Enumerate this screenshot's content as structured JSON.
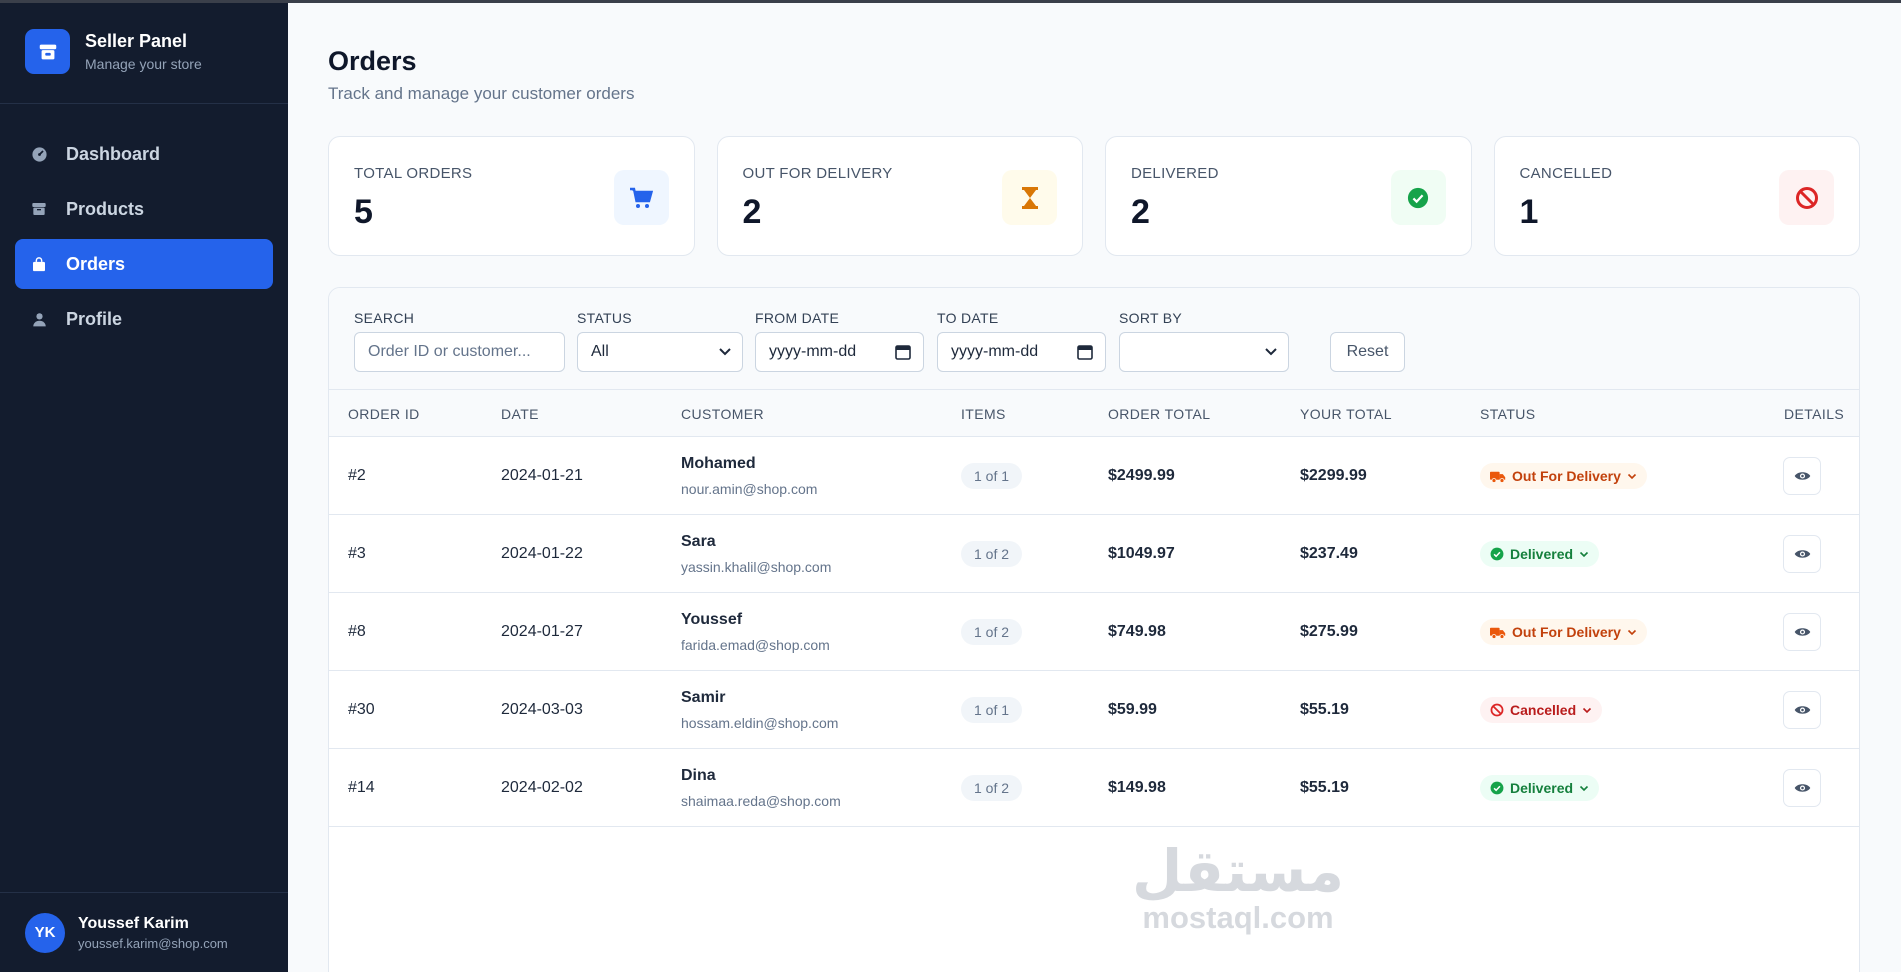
{
  "brand": {
    "title": "Seller Panel",
    "subtitle": "Manage your store"
  },
  "nav": [
    {
      "label": "Dashboard",
      "icon": "dashboard-icon",
      "active": false
    },
    {
      "label": "Products",
      "icon": "box-icon",
      "active": false
    },
    {
      "label": "Orders",
      "icon": "bag-icon",
      "active": true
    },
    {
      "label": "Profile",
      "icon": "user-icon",
      "active": false
    }
  ],
  "user": {
    "initials": "YK",
    "name": "Youssef Karim",
    "email": "youssef.karim@shop.com"
  },
  "page": {
    "title": "Orders",
    "subtitle": "Track and manage your customer orders"
  },
  "stats": [
    {
      "label": "TOTAL ORDERS",
      "value": "5",
      "icon": "cart-icon",
      "color": "#2563eb",
      "bg": "#eff6ff"
    },
    {
      "label": "OUT FOR DELIVERY",
      "value": "2",
      "icon": "hourglass-icon",
      "color": "#d97706",
      "bg": "#fffbeb"
    },
    {
      "label": "DELIVERED",
      "value": "2",
      "icon": "check-circle-icon",
      "color": "#16a34a",
      "bg": "#f0fdf4"
    },
    {
      "label": "CANCELLED",
      "value": "1",
      "icon": "ban-icon",
      "color": "#dc2626",
      "bg": "#fef2f2"
    }
  ],
  "filters": {
    "search_label": "SEARCH",
    "search_placeholder": "Order ID or customer...",
    "status_label": "STATUS",
    "status_value": "All",
    "from_label": "FROM DATE",
    "from_placeholder": "yyyy-mm-dd",
    "to_label": "TO DATE",
    "to_placeholder": "yyyy-mm-dd",
    "sort_label": "SORT BY",
    "sort_value": "",
    "reset_label": "Reset"
  },
  "table": {
    "columns": [
      "ORDER ID",
      "DATE",
      "CUSTOMER",
      "ITEMS",
      "ORDER TOTAL",
      "YOUR TOTAL",
      "STATUS",
      "DETAILS"
    ],
    "rows": [
      {
        "id": "#2",
        "date": "2024-01-21",
        "name": "Mohamed",
        "email": "nour.amin@shop.com",
        "items": "1 of 1",
        "total": "$2499.99",
        "yours": "$2299.99",
        "status": "Out For Delivery",
        "status_kind": "out"
      },
      {
        "id": "#3",
        "date": "2024-01-22",
        "name": "Sara",
        "email": "yassin.khalil@shop.com",
        "items": "1 of 2",
        "total": "$1049.97",
        "yours": "$237.49",
        "status": "Delivered",
        "status_kind": "del"
      },
      {
        "id": "#8",
        "date": "2024-01-27",
        "name": "Youssef",
        "email": "farida.emad@shop.com",
        "items": "1 of 2",
        "total": "$749.98",
        "yours": "$275.99",
        "status": "Out For Delivery",
        "status_kind": "out"
      },
      {
        "id": "#30",
        "date": "2024-03-03",
        "name": "Samir",
        "email": "hossam.eldin@shop.com",
        "items": "1 of 1",
        "total": "$59.99",
        "yours": "$55.19",
        "status": "Cancelled",
        "status_kind": "can"
      },
      {
        "id": "#14",
        "date": "2024-02-02",
        "name": "Dina",
        "email": "shaimaa.reda@shop.com",
        "items": "1 of 2",
        "total": "$149.98",
        "yours": "$55.19",
        "status": "Delivered",
        "status_kind": "del"
      }
    ]
  },
  "watermark": {
    "arabic": "مستقل",
    "latin": "mostaql.com"
  }
}
